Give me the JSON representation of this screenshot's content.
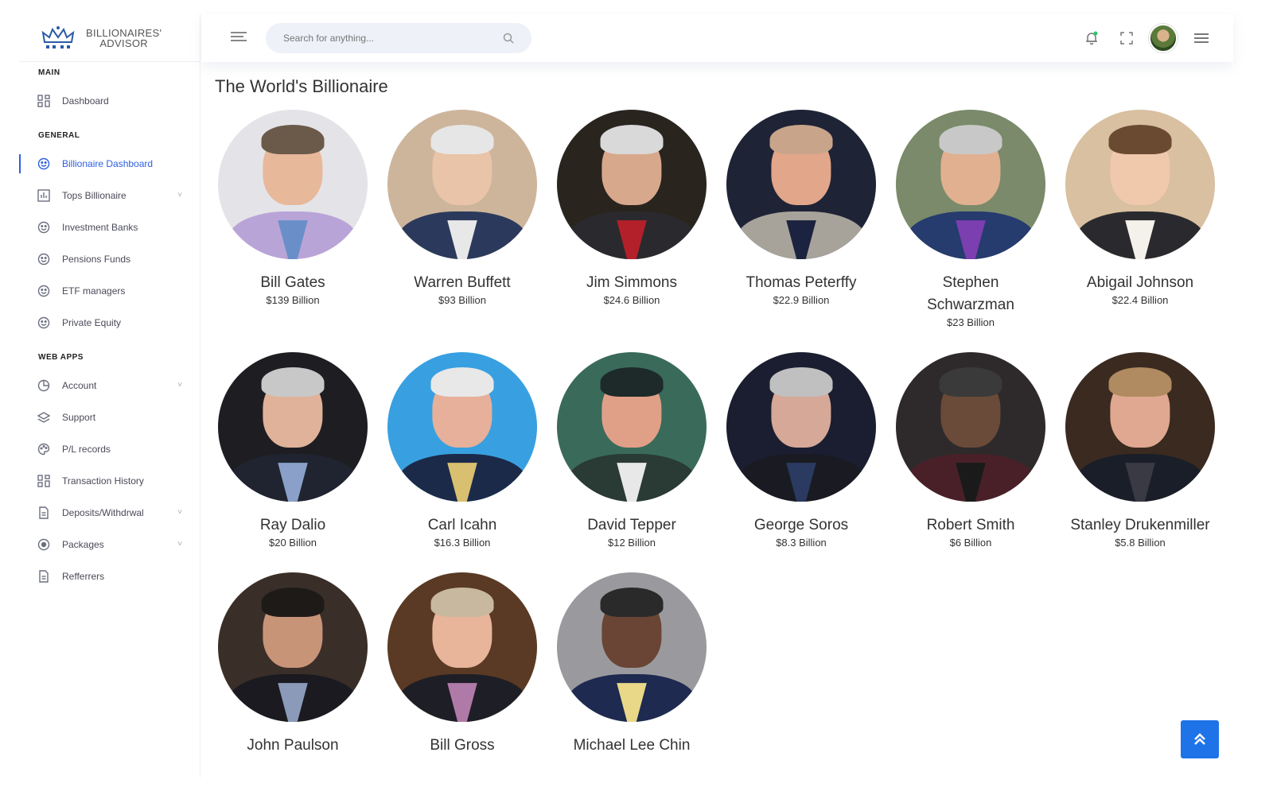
{
  "brand": {
    "line1": "BILLIONAIRES'",
    "line2": "ADVISOR"
  },
  "search": {
    "placeholder": "Search for anything..."
  },
  "sidebar": {
    "sections": [
      {
        "title": "MAIN",
        "items": [
          {
            "label": "Dashboard",
            "icon": "grid-icon"
          }
        ]
      },
      {
        "title": "GENERAL",
        "items": [
          {
            "label": "Billionaire Dashboard",
            "icon": "smiley-icon",
            "active": true
          },
          {
            "label": "Tops Billionaire",
            "icon": "bar-chart-icon",
            "chevron": true
          },
          {
            "label": "Investment Banks",
            "icon": "smiley-icon"
          },
          {
            "label": "Pensions Funds",
            "icon": "smiley-icon"
          },
          {
            "label": "ETF managers",
            "icon": "smiley-icon"
          },
          {
            "label": "Private Equity",
            "icon": "smiley-icon"
          }
        ]
      },
      {
        "title": "WEB APPS",
        "items": [
          {
            "label": "Account",
            "icon": "pie-chart-icon",
            "chevron": true
          },
          {
            "label": "Support",
            "icon": "layers-icon"
          },
          {
            "label": "P/L records",
            "icon": "palette-icon"
          },
          {
            "label": "Transaction History",
            "icon": "grid-icon"
          },
          {
            "label": "Deposits/Withdrwal",
            "icon": "document-icon",
            "chevron": true
          },
          {
            "label": "Packages",
            "icon": "settings-icon",
            "chevron": true
          },
          {
            "label": "Refferrers",
            "icon": "document-icon"
          }
        ]
      }
    ]
  },
  "main": {
    "title": "The World's Billionaire",
    "people": [
      {
        "name": "Bill Gates",
        "worth": "$139 Billion",
        "bg": "#e4e4e8",
        "skin": "#e8b89a",
        "hair": "#6b5a4a",
        "suit": "#b9a4d8",
        "shirt": "#6a8fc8"
      },
      {
        "name": "Warren Buffett",
        "worth": "$93 Billion",
        "bg": "#cdb59c",
        "skin": "#e9c4a8",
        "hair": "#e6e6e6",
        "suit": "#2b3a5c",
        "shirt": "#e8e8e8"
      },
      {
        "name": "Jim Simmons",
        "worth": "$24.6 Billion",
        "bg": "#2a241f",
        "skin": "#d8a88c",
        "hair": "#d9d9d9",
        "suit": "#2a2a2e",
        "shirt": "#b3202a"
      },
      {
        "name": "Thomas Peterffy",
        "worth": "$22.9 Billion",
        "bg": "#1f2336",
        "skin": "#e2a68a",
        "hair": "#c8a58a",
        "suit": "#a8a39a",
        "shirt": "#1b2340"
      },
      {
        "name": "Stephen Schwarzman",
        "worth": "$23 Billion",
        "bg": "#7a8a6a",
        "skin": "#e0b090",
        "hair": "#c8c8c8",
        "suit": "#263b6e",
        "shirt": "#7b3fb0"
      },
      {
        "name": "Abigail Johnson",
        "worth": "$22.4 Billion",
        "bg": "#d8c0a0",
        "skin": "#f0c8ac",
        "hair": "#6a4a30",
        "suit": "#2a2a2e",
        "shirt": "#f4f0ea"
      },
      {
        "name": "Ray Dalio",
        "worth": "$20 Billion",
        "bg": "#1e1e22",
        "skin": "#e0b29a",
        "hair": "#c8c8c8",
        "suit": "#1f2430",
        "shirt": "#8aa0c8"
      },
      {
        "name": "Carl Icahn",
        "worth": "$16.3 Billion",
        "bg": "#38a0e0",
        "skin": "#e6b09a",
        "hair": "#e8e8e8",
        "suit": "#1c2a4a",
        "shirt": "#d8c070"
      },
      {
        "name": "David Tepper",
        "worth": "$12 Billion",
        "bg": "#3a6a5a",
        "skin": "#e0a088",
        "hair": "#1e2a2a",
        "suit": "#2a3a34",
        "shirt": "#e8e8e8"
      },
      {
        "name": "George Soros",
        "worth": "$8.3 Billion",
        "bg": "#1a1e30",
        "skin": "#d6a898",
        "hair": "#c0c0c0",
        "suit": "#1a1a22",
        "shirt": "#2a3a60"
      },
      {
        "name": "Robert Smith",
        "worth": "$6 Billion",
        "bg": "#2e2a2c",
        "skin": "#6a4a38",
        "hair": "#3a3a3a",
        "suit": "#4a2028",
        "shirt": "#1a1a1a"
      },
      {
        "name": "Stanley Drukenmiller",
        "worth": "$5.8 Billion",
        "bg": "#3a2a20",
        "skin": "#e0a890",
        "hair": "#b08a60",
        "suit": "#1a1e28",
        "shirt": "#3a3a44"
      },
      {
        "name": "John Paulson",
        "worth": "",
        "bg": "#3a2e28",
        "skin": "#c89478",
        "hair": "#1e1a18",
        "suit": "#1a1a20",
        "shirt": "#8a9ab8"
      },
      {
        "name": "Bill Gross",
        "worth": "",
        "bg": "#5a3a24",
        "skin": "#e8b49a",
        "hair": "#c8b8a0",
        "suit": "#1e1e26",
        "shirt": "#b07aa8"
      },
      {
        "name": "Michael Lee Chin",
        "worth": "",
        "bg": "#9a9a9e",
        "skin": "#6a4434",
        "hair": "#2a2a2a",
        "suit": "#1e2a50",
        "shirt": "#e8d888"
      }
    ]
  },
  "colors": {
    "accent": "#2d5fe0",
    "scroll_button": "#1e73e8"
  }
}
